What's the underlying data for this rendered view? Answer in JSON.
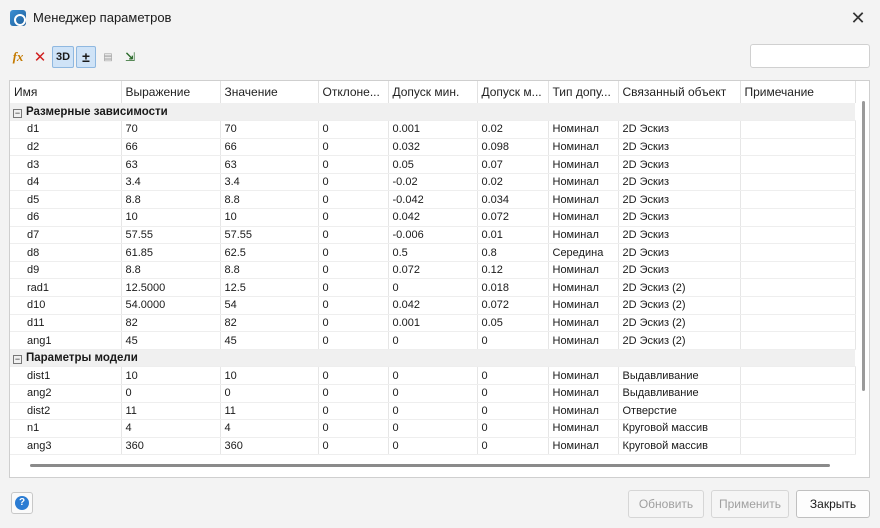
{
  "window": {
    "title": "Менеджер параметров",
    "close_glyph": "✕"
  },
  "toolbar": {
    "buttons": [
      {
        "name": "fx-icon",
        "glyph": "fx"
      },
      {
        "name": "delete-icon",
        "glyph": "✕"
      },
      {
        "name": "3d-icon",
        "glyph": "3D"
      },
      {
        "name": "plus-minus-icon",
        "glyph": "±"
      },
      {
        "name": "import-icon",
        "glyph": "▤"
      },
      {
        "name": "export-icon",
        "glyph": "⇲"
      }
    ]
  },
  "search": {
    "placeholder": ""
  },
  "table": {
    "columns": [
      "Имя",
      "Выражение",
      "Значение",
      "Отклоне...",
      "Допуск мин.",
      "Допуск м...",
      "Тип допу...",
      "Связанный объект",
      "Примечание"
    ],
    "groups": [
      {
        "label": "Размерные зависимости",
        "rows": [
          [
            "d1",
            "70",
            "70",
            "0",
            "0.001",
            "0.02",
            "Номинал",
            "2D Эскиз",
            ""
          ],
          [
            "d2",
            "66",
            "66",
            "0",
            "0.032",
            "0.098",
            "Номинал",
            "2D Эскиз",
            ""
          ],
          [
            "d3",
            "63",
            "63",
            "0",
            "0.05",
            "0.07",
            "Номинал",
            "2D Эскиз",
            ""
          ],
          [
            "d4",
            "3.4",
            "3.4",
            "0",
            "-0.02",
            "0.02",
            "Номинал",
            "2D Эскиз",
            ""
          ],
          [
            "d5",
            "8.8",
            "8.8",
            "0",
            "-0.042",
            "0.034",
            "Номинал",
            "2D Эскиз",
            ""
          ],
          [
            "d6",
            "10",
            "10",
            "0",
            "0.042",
            "0.072",
            "Номинал",
            "2D Эскиз",
            ""
          ],
          [
            "d7",
            "57.55",
            "57.55",
            "0",
            "-0.006",
            "0.01",
            "Номинал",
            "2D Эскиз",
            ""
          ],
          [
            "d8",
            "61.85",
            "62.5",
            "0",
            "0.5",
            "0.8",
            "Середина",
            "2D Эскиз",
            ""
          ],
          [
            "d9",
            "8.8",
            "8.8",
            "0",
            "0.072",
            "0.12",
            "Номинал",
            "2D Эскиз",
            ""
          ],
          [
            "rad1",
            "12.5000",
            "12.5",
            "0",
            "0",
            "0.018",
            "Номинал",
            "2D Эскиз (2)",
            ""
          ],
          [
            "d10",
            "54.0000",
            "54",
            "0",
            "0.042",
            "0.072",
            "Номинал",
            "2D Эскиз (2)",
            ""
          ],
          [
            "d11",
            "82",
            "82",
            "0",
            "0.001",
            "0.05",
            "Номинал",
            "2D Эскиз (2)",
            ""
          ],
          [
            "ang1",
            "45",
            "45",
            "0",
            "0",
            "0",
            "Номинал",
            "2D Эскиз (2)",
            ""
          ]
        ]
      },
      {
        "label": "Параметры модели",
        "rows": [
          [
            "dist1",
            "10",
            "10",
            "0",
            "0",
            "0",
            "Номинал",
            "Выдавливание",
            ""
          ],
          [
            "ang2",
            "0",
            "0",
            "0",
            "0",
            "0",
            "Номинал",
            "Выдавливание",
            ""
          ],
          [
            "dist2",
            "11",
            "11",
            "0",
            "0",
            "0",
            "Номинал",
            "Отверстие",
            ""
          ],
          [
            "n1",
            "4",
            "4",
            "0",
            "0",
            "0",
            "Номинал",
            "Круговой массив",
            ""
          ],
          [
            "ang3",
            "360",
            "360",
            "0",
            "0",
            "0",
            "Номинал",
            "Круговой массив",
            ""
          ]
        ]
      }
    ]
  },
  "footer": {
    "help_glyph": "?",
    "refresh_label": "Обновить",
    "apply_label": "Применить",
    "close_label": "Закрыть"
  }
}
